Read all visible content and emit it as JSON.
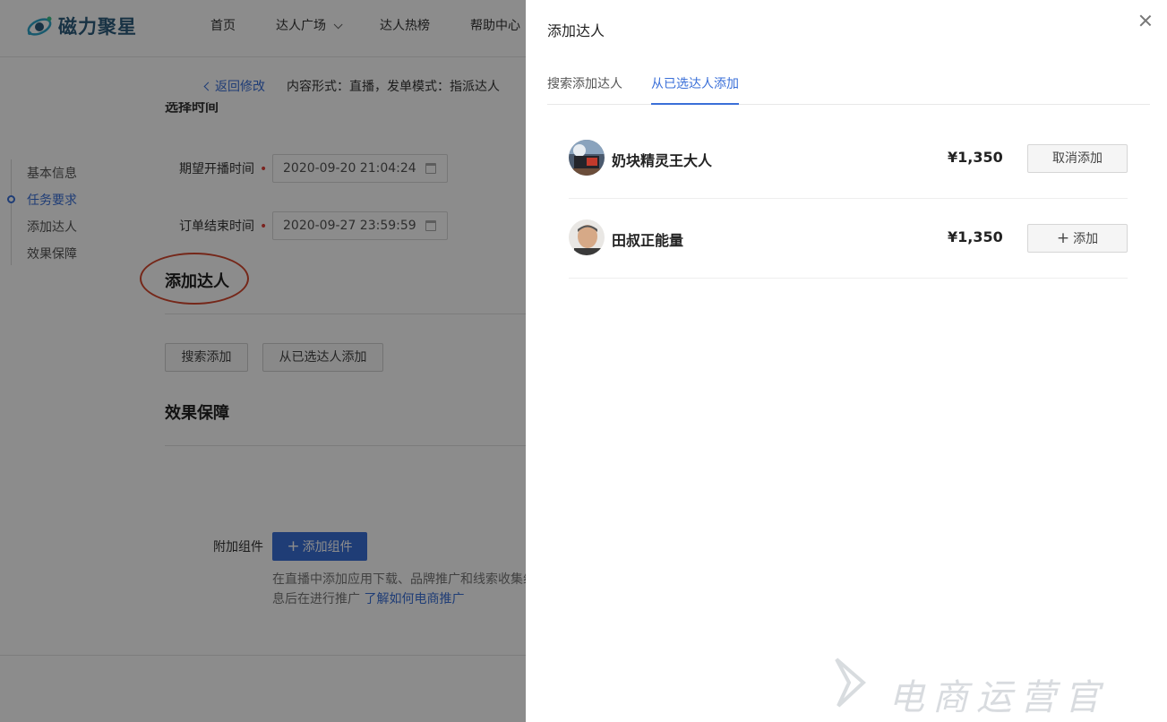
{
  "header": {
    "logo_text": "磁力聚星",
    "nav": [
      {
        "label": "首页"
      },
      {
        "label": "达人广场"
      },
      {
        "label": "达人热榜"
      },
      {
        "label": "帮助中心"
      }
    ]
  },
  "crumb": {
    "back_label": "返回修改",
    "content_form": "内容形式：直播，发单模式：指派达人"
  },
  "page": {
    "cut_heading": "选择时间",
    "sidebar": [
      {
        "label": "基本信息"
      },
      {
        "label": "任务要求"
      },
      {
        "label": "添加达人"
      },
      {
        "label": "效果保障"
      }
    ],
    "start_time": {
      "label": "期望开播时间",
      "value": "2020-09-20 21:04:24"
    },
    "end_time": {
      "label": "订单结束时间",
      "value": "2020-09-27 23:59:59"
    },
    "add_talent_title": "添加达人",
    "search_add_btn": "搜索添加",
    "from_selected_btn": "从已选达人添加",
    "effect_title": "效果保障",
    "addon_label": "附加组件",
    "addon_btn": "添加组件",
    "help_line1": "在直播中添加应用下载、品牌推广和线索收集组",
    "help_line2": "息后在进行推广",
    "help_link": "了解如何电商推广"
  },
  "drawer": {
    "title": "添加达人",
    "tabs": [
      {
        "label": "搜索添加达人",
        "active": false
      },
      {
        "label": "从已选达人添加",
        "active": true
      }
    ],
    "rows": [
      {
        "name": "奶块精灵王大人",
        "price": "¥1,350",
        "action": "取消添加"
      },
      {
        "name": "田叔正能量",
        "price": "¥1,350",
        "action": "添加"
      }
    ]
  },
  "watermark": "电商运营官",
  "colors": {
    "accent": "#3a6fd8",
    "required": "#e0403a",
    "circle": "#d6482e"
  }
}
